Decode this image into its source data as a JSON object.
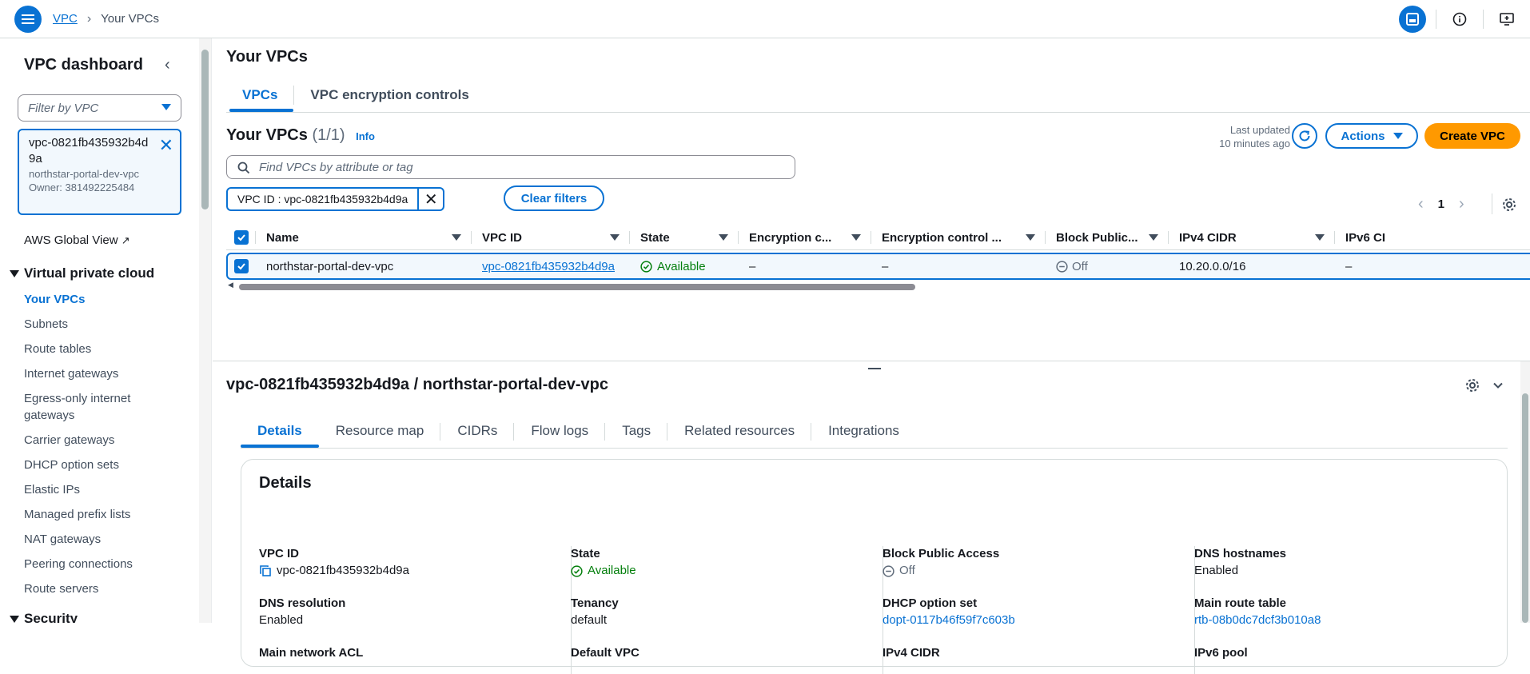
{
  "breadcrumb": {
    "root": "VPC",
    "current": "Your VPCs"
  },
  "sidebar": {
    "title": "VPC dashboard",
    "filter_placeholder": "Filter by VPC",
    "selected_vpc": {
      "id": "vpc-0821fb435932b4d9a",
      "name": "northstar-portal-dev-vpc",
      "owner": "Owner: 381492225484"
    },
    "global_view": "AWS Global View",
    "section_vpc": "Virtual private cloud",
    "items": [
      "Your VPCs",
      "Subnets",
      "Route tables",
      "Internet gateways",
      "Egress-only internet gateways",
      "Carrier gateways",
      "DHCP option sets",
      "Elastic IPs",
      "Managed prefix lists",
      "NAT gateways",
      "Peering connections",
      "Route servers"
    ],
    "section_security": "Security"
  },
  "page": {
    "title": "Your VPCs",
    "tabs": [
      "VPCs",
      "VPC encryption controls"
    ],
    "table_title": "Your VPCs",
    "table_count": "(1/1)",
    "info": "Info",
    "last_updated_label": "Last updated",
    "last_updated_value": "10 minutes ago",
    "actions": "Actions",
    "create": "Create VPC",
    "search_placeholder": "Find VPCs by attribute or tag",
    "filter_chip": "VPC ID : vpc-0821fb435932b4d9a",
    "clear_filters": "Clear filters",
    "page_num": "1"
  },
  "table": {
    "columns": [
      "Name",
      "VPC ID",
      "State",
      "Encryption c...",
      "Encryption control ...",
      "Block Public...",
      "IPv4 CIDR",
      "IPv6 CI"
    ],
    "row": {
      "name": "northstar-portal-dev-vpc",
      "vpc_id": "vpc-0821fb435932b4d9a",
      "state": "Available",
      "enc_c": "–",
      "enc_control": "–",
      "block_public": "Off",
      "ipv4": "10.20.0.0/16",
      "ipv6": "–"
    }
  },
  "details": {
    "title": "vpc-0821fb435932b4d9a / northstar-portal-dev-vpc",
    "tabs": [
      "Details",
      "Resource map",
      "CIDRs",
      "Flow logs",
      "Tags",
      "Related resources",
      "Integrations"
    ],
    "card_title": "Details",
    "fields": {
      "vpc_id_k": "VPC ID",
      "vpc_id_v": "vpc-0821fb435932b4d9a",
      "state_k": "State",
      "state_v": "Available",
      "bpa_k": "Block Public Access",
      "bpa_v": "Off",
      "dnsh_k": "DNS hostnames",
      "dnsh_v": "Enabled",
      "dnsr_k": "DNS resolution",
      "dnsr_v": "Enabled",
      "ten_k": "Tenancy",
      "ten_v": "default",
      "dhcp_k": "DHCP option set",
      "dhcp_v": "dopt-0117b46f59f7c603b",
      "mrt_k": "Main route table",
      "mrt_v": "rtb-08b0dc7dcf3b010a8",
      "acl_k": "Main network ACL",
      "defv_k": "Default VPC",
      "ipv4_k": "IPv4 CIDR",
      "ipv6_k": "IPv6 pool"
    }
  },
  "colors": {
    "accent": "#0972d3",
    "primary_button": "#ff9900",
    "success": "#037f0c"
  }
}
